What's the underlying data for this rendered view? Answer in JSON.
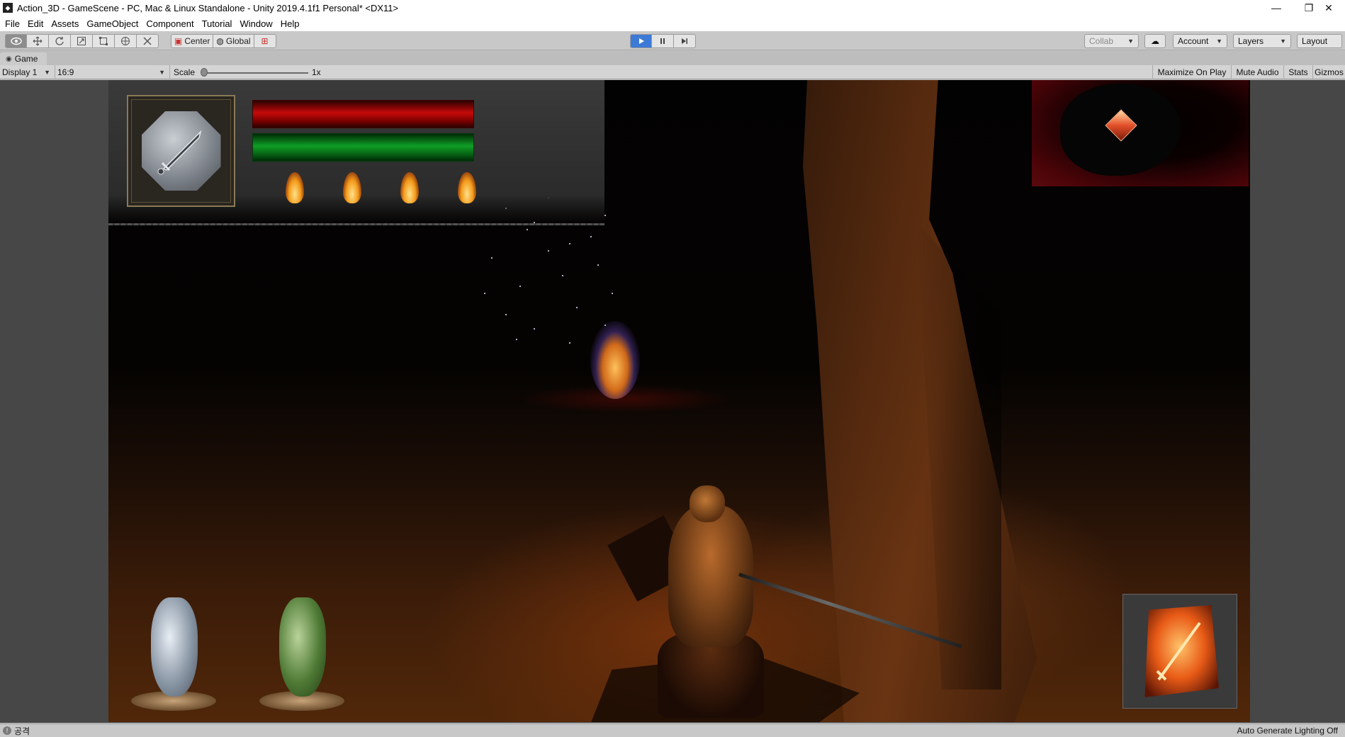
{
  "window": {
    "title": "Action_3D - GameScene - PC, Mac & Linux Standalone - Unity 2019.4.1f1 Personal* <DX11>",
    "minimize_glyph": "—",
    "restore_glyph": "❐",
    "close_glyph": "✕"
  },
  "menu": [
    "File",
    "Edit",
    "Assets",
    "GameObject",
    "Component",
    "Tutorial",
    "Window",
    "Help"
  ],
  "toolbar": {
    "tools": [
      "view-tool-icon",
      "move-tool-icon",
      "rotate-tool-icon",
      "scale-tool-icon",
      "rect-tool-icon",
      "transform-tool-icon",
      "custom-tool-icon"
    ],
    "pivot_label": "Center",
    "space_label": "Global",
    "collab_label": "Collab",
    "account_label": "Account",
    "layers_label": "Layers",
    "layout_label": "Layout"
  },
  "game_tab": {
    "label": "Game"
  },
  "game_controls": {
    "display": "Display 1",
    "aspect": "16:9",
    "scale_label": "Scale",
    "scale_value": "1x",
    "maximize_label": "Maximize On Play",
    "mute_label": "Mute Audio",
    "stats_label": "Stats",
    "gizmos_label": "Gizmos"
  },
  "hud": {
    "health_fill": 1.0,
    "stamina_fill": 1.0,
    "flame_count": 4,
    "colors": {
      "health": "#c50a0a",
      "stamina": "#0f9e25",
      "flame": "#f39a1a"
    }
  },
  "status": {
    "message": "공격",
    "right_text": "Auto Generate Lighting Off"
  }
}
